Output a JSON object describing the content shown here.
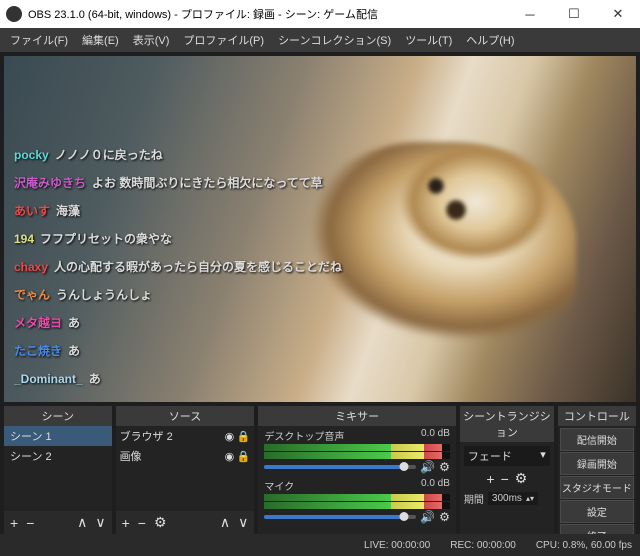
{
  "title": "OBS 23.1.0 (64-bit, windows) - プロファイル: 録画 - シーン: ゲーム配信",
  "menu": [
    "ファイル(F)",
    "編集(E)",
    "表示(V)",
    "プロファイル(P)",
    "シーンコレクション(S)",
    "ツール(T)",
    "ヘルプ(H)"
  ],
  "chat": [
    {
      "user": "pocky",
      "color": "#5ad8d8",
      "msg": "ノノノ０に戻ったね"
    },
    {
      "user": "沢庵みゆきち",
      "color": "#ca5aca",
      "msg": "よお 数時間ぶりにきたら相欠になってて草"
    },
    {
      "user": "あいす",
      "color": "#ea4a4a",
      "msg": "海藻"
    },
    {
      "user": "194",
      "color": "#e0e080",
      "msg": "フフプリセットの衆やな"
    },
    {
      "user": "chaxy",
      "color": "#ea4a4a",
      "msg": "人の心配する暇があったら自分の夏を感じることだね"
    },
    {
      "user": "でゃん",
      "color": "#ea8a4a",
      "msg": "うんしょうんしょ"
    },
    {
      "user": "メタ越ヨ",
      "color": "#ea4aaa",
      "msg": "あ"
    },
    {
      "user": "たこ焼き",
      "color": "#4a8aea",
      "msg": "あ"
    },
    {
      "user": "_Dominant_",
      "color": "#aad8ea",
      "msg": "あ"
    }
  ],
  "panels": {
    "scenes": {
      "title": "シーン",
      "items": [
        "シーン 1",
        "シーン 2"
      ]
    },
    "sources": {
      "title": "ソース",
      "items": [
        {
          "name": "ブラウザ 2",
          "eye": "◉",
          "lock": "🔒"
        },
        {
          "name": "画像",
          "eye": "◉",
          "lock": "🔒"
        }
      ]
    },
    "mixer": {
      "title": "ミキサー",
      "items": [
        {
          "name": "デスクトップ音声",
          "db": "0.0 dB",
          "level": 0.92
        },
        {
          "name": "マイク",
          "db": "0.0 dB",
          "level": 0.92
        }
      ]
    },
    "trans": {
      "title": "シーントランジション",
      "selected": "フェード",
      "dur_label": "期間",
      "dur": "300ms"
    },
    "controls": {
      "title": "コントロール",
      "buttons": [
        "配信開始",
        "録画開始",
        "スタジオモード",
        "設定",
        "終了"
      ]
    }
  },
  "status": {
    "live": "LIVE: 00:00:00",
    "rec": "REC: 00:00:00",
    "cpu": "CPU: 0.8%, 60.00 fps"
  }
}
